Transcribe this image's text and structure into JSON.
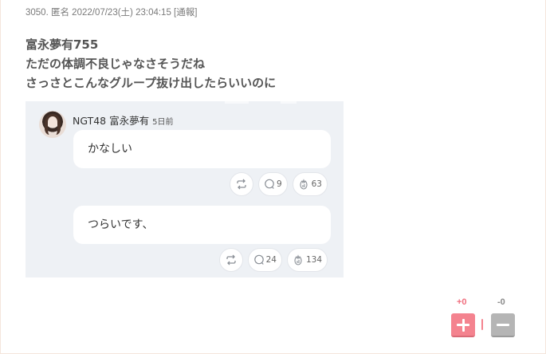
{
  "post": {
    "meta": "3050. 匿名 2022/07/23(土) 23:04:15",
    "report_label": "[通報]",
    "lines": [
      "富永夢有755",
      "ただの体調不良じゃなさそうだね",
      "さっさとこんなグループ抜け出したらいいのに"
    ]
  },
  "embed": {
    "author": "NGT48 富永夢有",
    "time": "5日前",
    "messages": [
      {
        "text": "かなしい",
        "comments": "9",
        "claps": "63"
      },
      {
        "text": "つらいです、",
        "comments": "24",
        "claps": "134"
      }
    ]
  },
  "votes": {
    "plus_count": "+0",
    "minus_count": "-0"
  },
  "colors": {
    "plus": "#f4838f",
    "minus": "#b5b5b5",
    "embed_bg": "#eef1f5"
  }
}
